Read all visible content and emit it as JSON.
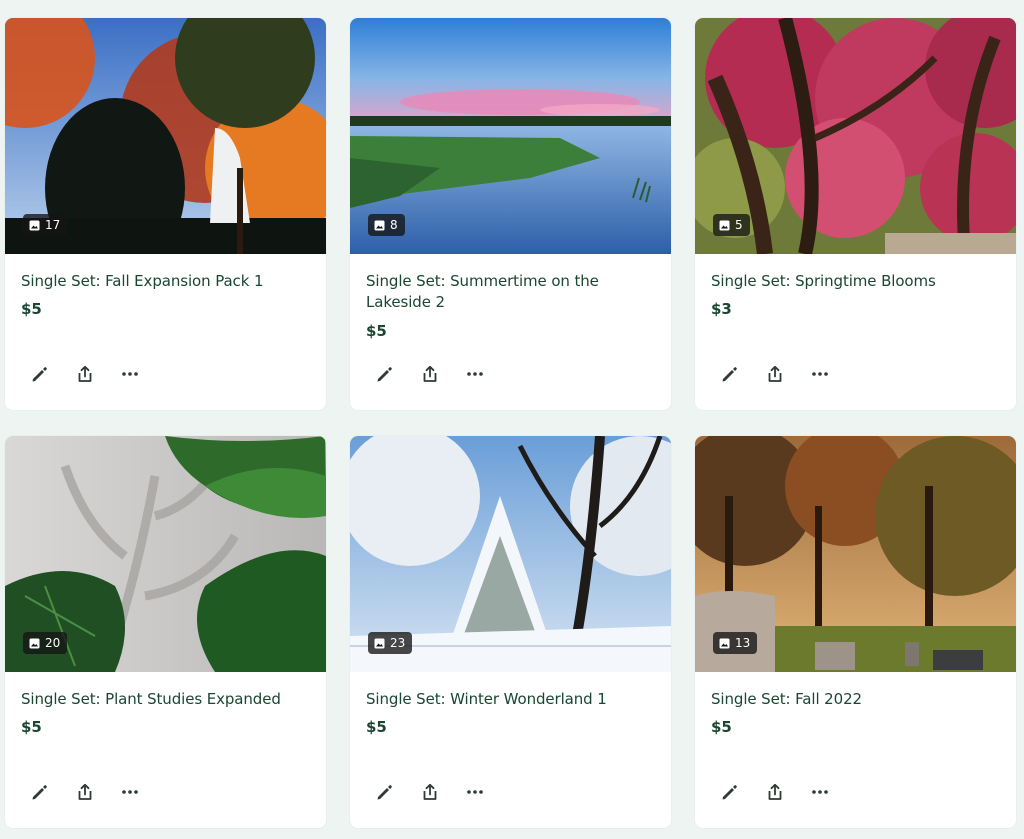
{
  "collections": [
    {
      "title": "Single Set: Fall Expansion Pack 1",
      "price": "$5",
      "photo_count": "17",
      "icon": "image-icon",
      "actions": [
        "edit-icon",
        "share-icon",
        "more-icon"
      ]
    },
    {
      "title": "Single Set: Summertime on the Lakeside 2",
      "price": "$5",
      "photo_count": "8",
      "icon": "image-icon",
      "actions": [
        "edit-icon",
        "share-icon",
        "more-icon"
      ]
    },
    {
      "title": "Single Set: Springtime Blooms",
      "price": "$3",
      "photo_count": "5",
      "icon": "image-icon",
      "actions": [
        "edit-icon",
        "share-icon",
        "more-icon"
      ]
    },
    {
      "title": "Single Set: Plant Studies Expanded",
      "price": "$5",
      "photo_count": "20",
      "icon": "image-icon",
      "actions": [
        "edit-icon",
        "share-icon",
        "more-icon"
      ]
    },
    {
      "title": "Single Set: Winter Wonderland 1",
      "price": "$5",
      "photo_count": "23",
      "icon": "image-icon",
      "actions": [
        "edit-icon",
        "share-icon",
        "more-icon"
      ]
    },
    {
      "title": "Single Set: Fall 2022",
      "price": "$5",
      "photo_count": "13",
      "icon": "image-icon",
      "actions": [
        "edit-icon",
        "share-icon",
        "more-icon"
      ]
    }
  ],
  "theme": {
    "background": "#eef4f1",
    "card": "#ffffff",
    "text": "#1a4731",
    "badge": "#141414"
  }
}
